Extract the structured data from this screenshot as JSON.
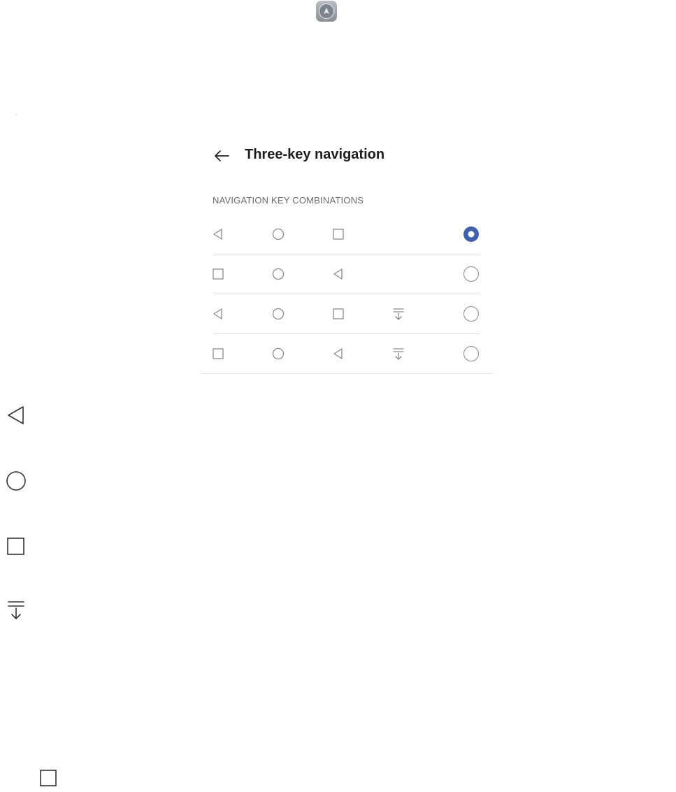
{
  "header": {
    "title": "Three-key navigation"
  },
  "section": {
    "label": "NAVIGATION KEY COMBINATIONS"
  },
  "combinations": [
    {
      "keys": [
        "back-triangle",
        "home-circle",
        "recent-square"
      ],
      "selected": true
    },
    {
      "keys": [
        "recent-square",
        "home-circle",
        "back-triangle"
      ],
      "selected": false
    },
    {
      "keys": [
        "back-triangle",
        "home-circle",
        "recent-square",
        "notification-pull-down"
      ],
      "selected": false
    },
    {
      "keys": [
        "recent-square",
        "home-circle",
        "back-triangle",
        "notification-pull-down"
      ],
      "selected": false
    }
  ],
  "legend_icons": [
    "back-triangle",
    "home-circle",
    "recent-square",
    "notification-pull-down"
  ],
  "colors": {
    "accent": "#3f5fb0",
    "icon": "#8a8a8a",
    "divider": "#dedede"
  }
}
